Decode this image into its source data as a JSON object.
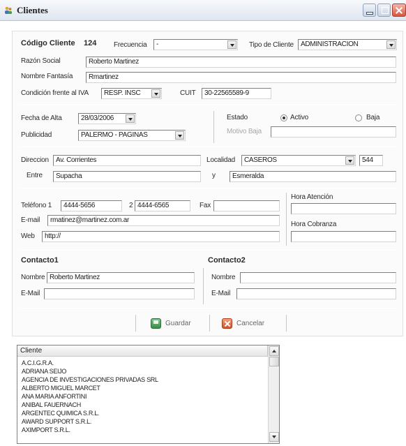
{
  "window": {
    "title": "Clientes"
  },
  "header": {
    "code_label": "Código Cliente",
    "code_value": "124",
    "frecuencia_label": "Frecuencia",
    "frecuencia_value": "-",
    "tipo_label": "Tipo de Cliente",
    "tipo_value": "ADMINISTRACION"
  },
  "identity": {
    "razon_label": "Razón Social",
    "razon_value": "Roberto Martinez",
    "fantasia_label": "Nombre Fantasía",
    "fantasia_value": "Rmartinez",
    "iva_label": "Condición frente al IVA",
    "iva_value": "RESP. INSC",
    "cuit_label": "CUIT",
    "cuit_value": "30-22565589-9"
  },
  "status": {
    "alta_label": "Fecha de Alta",
    "alta_value": "28/03/2006",
    "publicidad_label": "Publicidad",
    "publicidad_value": "PALERMO - PAGINAS",
    "estado_label": "Estado",
    "activo_label": "Activo",
    "baja_label": "Baja",
    "estado_selected": "Activo",
    "motivo_label": "Motivo Baja",
    "motivo_value": ""
  },
  "address": {
    "direccion_label": "Direccion",
    "direccion_value": "Av. Corrientes",
    "localidad_label": "Localidad",
    "localidad_value": "CASEROS",
    "numero_value": "544",
    "entre_label": "Entre",
    "entre_value": "Supacha",
    "y_label": "y",
    "y_value": "Esmeralda"
  },
  "contact_info": {
    "tel1_label": "Teléfono 1",
    "tel1_value": "4444-5656",
    "tel2_label": "2",
    "tel2_value": "4444-6565",
    "fax_label": "Fax",
    "fax_value": "",
    "email_label": "E-mail",
    "email_value": "rmatinez@martinez.com.ar",
    "web_label": "Web",
    "web_value": "http://",
    "atencion_label": "Hora Atención",
    "atencion_value": "",
    "cobranza_label": "Hora Cobranza",
    "cobranza_value": ""
  },
  "contacto1": {
    "title": "Contacto1",
    "nombre_label": "Nombre",
    "nombre_value": "Roberto Martinez",
    "email_label": "E-Mail",
    "email_value": ""
  },
  "contacto2": {
    "title": "Contacto2",
    "nombre_label": "Nombre",
    "nombre_value": "",
    "email_label": "E-Mail",
    "email_value": ""
  },
  "actions": {
    "save_label": "Guardar",
    "cancel_label": "Cancelar"
  },
  "client_list": {
    "header": "Cliente",
    "rows": [
      "A.C.I.G.R.A.",
      "ADRIANA SEIJO",
      "AGENCIA DE INVESTIGACIONES PRIVADAS SRL",
      "ALBERTO MIGUEL MARCET",
      "ANA MARIA ANFORTINI",
      "ANIBAL FAUERNACH",
      "ARGENTEC QUIMICA S.R.L.",
      "AWARD SUPPORT S.R.L.",
      "AXIMPORT S.R.L."
    ]
  }
}
